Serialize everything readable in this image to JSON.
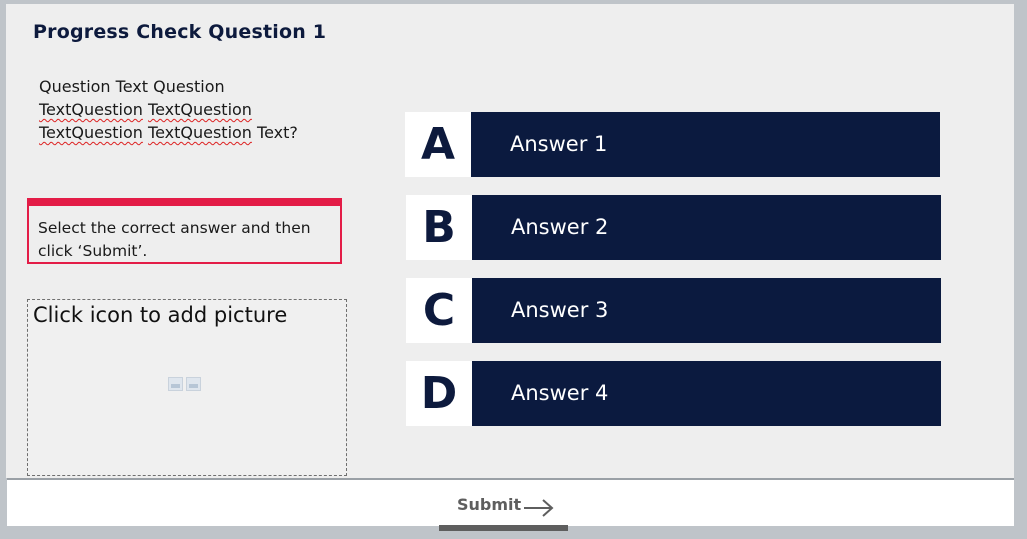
{
  "title": "Progress Check Question 1",
  "question": {
    "line1": "Question Text Question",
    "line2a": "TextQuestion",
    "line2b": "TextQuestion",
    "line3a": "TextQuestion",
    "line3b": "TextQuestion",
    "line3c": "Text?"
  },
  "instruction": "Select the correct answer and then click ‘Submit’.",
  "picture_placeholder": "Click icon to add picture",
  "answers": [
    {
      "letter": "A",
      "label": "Answer 1"
    },
    {
      "letter": "B",
      "label": "Answer 2"
    },
    {
      "letter": "C",
      "label": "Answer 3"
    },
    {
      "letter": "D",
      "label": "Answer 4"
    }
  ],
  "submit": {
    "label": "Submit",
    "icon": "arrow-right-icon"
  },
  "colors": {
    "navy": "#0b1a3f",
    "accent_red": "#e31c47",
    "slide_bg": "#eeeeee"
  }
}
